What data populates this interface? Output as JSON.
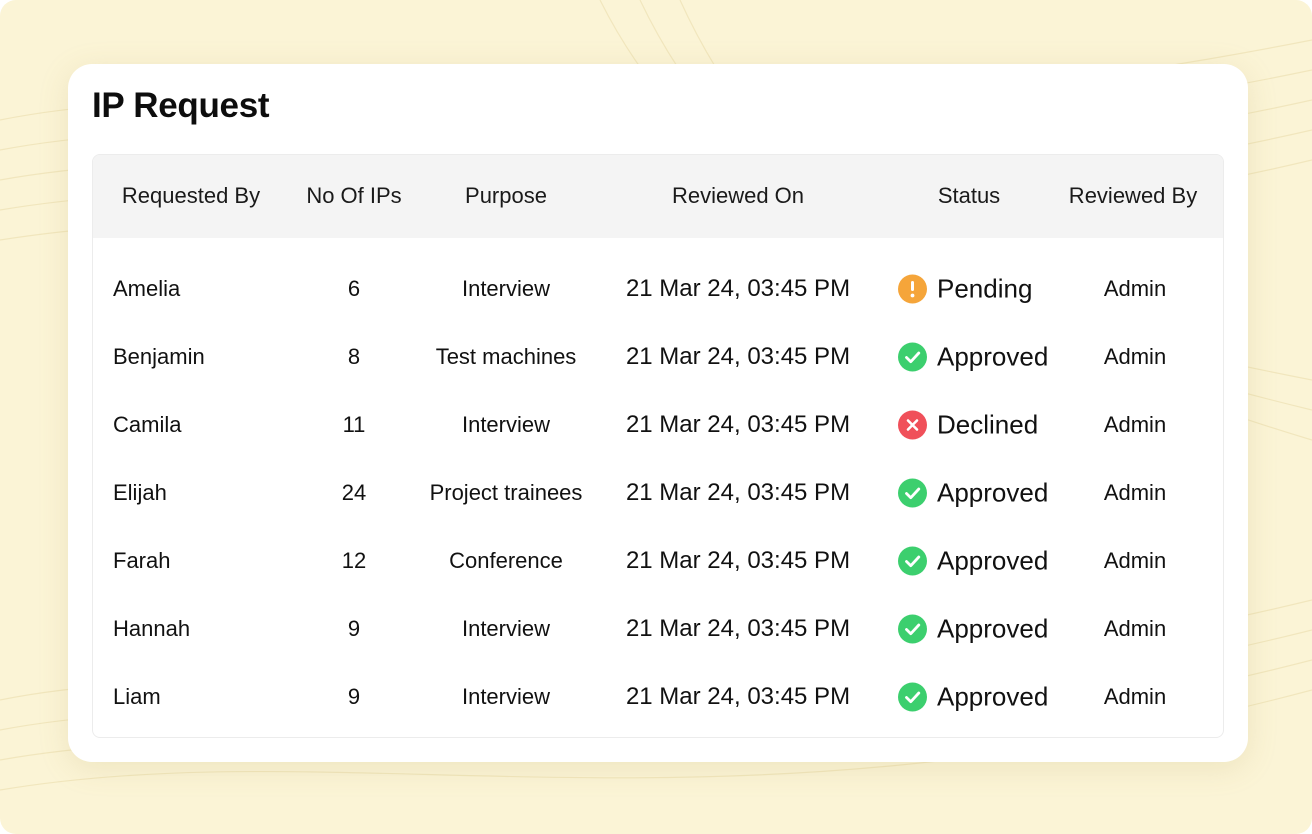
{
  "page": {
    "title": "IP Request"
  },
  "table": {
    "headers": {
      "requested_by": "Requested By",
      "no_of_ips": "No Of IPs",
      "purpose": "Purpose",
      "reviewed_on": "Reviewed On",
      "status": "Status",
      "reviewed_by": "Reviewed By"
    },
    "rows": [
      {
        "requested_by": "Amelia",
        "no_of_ips": "6",
        "purpose": "Interview",
        "reviewed_on": "21 Mar 24, 03:45 PM",
        "status": "Pending",
        "reviewed_by": "Admin"
      },
      {
        "requested_by": "Benjamin",
        "no_of_ips": "8",
        "purpose": "Test machines",
        "reviewed_on": "21 Mar 24, 03:45 PM",
        "status": "Approved",
        "reviewed_by": "Admin"
      },
      {
        "requested_by": "Camila",
        "no_of_ips": "11",
        "purpose": "Interview",
        "reviewed_on": "21 Mar 24, 03:45 PM",
        "status": "Declined",
        "reviewed_by": "Admin"
      },
      {
        "requested_by": "Elijah",
        "no_of_ips": "24",
        "purpose": "Project trainees",
        "reviewed_on": "21 Mar 24, 03:45 PM",
        "status": "Approved",
        "reviewed_by": "Admin"
      },
      {
        "requested_by": "Farah",
        "no_of_ips": "12",
        "purpose": "Conference",
        "reviewed_on": "21 Mar 24, 03:45 PM",
        "status": "Approved",
        "reviewed_by": "Admin"
      },
      {
        "requested_by": "Hannah",
        "no_of_ips": "9",
        "purpose": "Interview",
        "reviewed_on": "21 Mar 24, 03:45 PM",
        "status": "Approved",
        "reviewed_by": "Admin"
      },
      {
        "requested_by": "Liam",
        "no_of_ips": "9",
        "purpose": "Interview",
        "reviewed_on": "21 Mar 24, 03:45 PM",
        "status": "Approved",
        "reviewed_by": "Admin"
      }
    ]
  },
  "status_styles": {
    "Pending": {
      "icon": "exclamation-icon",
      "color": "#f5a53a"
    },
    "Approved": {
      "icon": "check-icon",
      "color": "#3ccf6e"
    },
    "Declined": {
      "icon": "close-icon",
      "color": "#f0505a"
    }
  },
  "colors": {
    "background": "#fbf4d6",
    "card": "#ffffff",
    "header_row": "#f4f4f4"
  }
}
